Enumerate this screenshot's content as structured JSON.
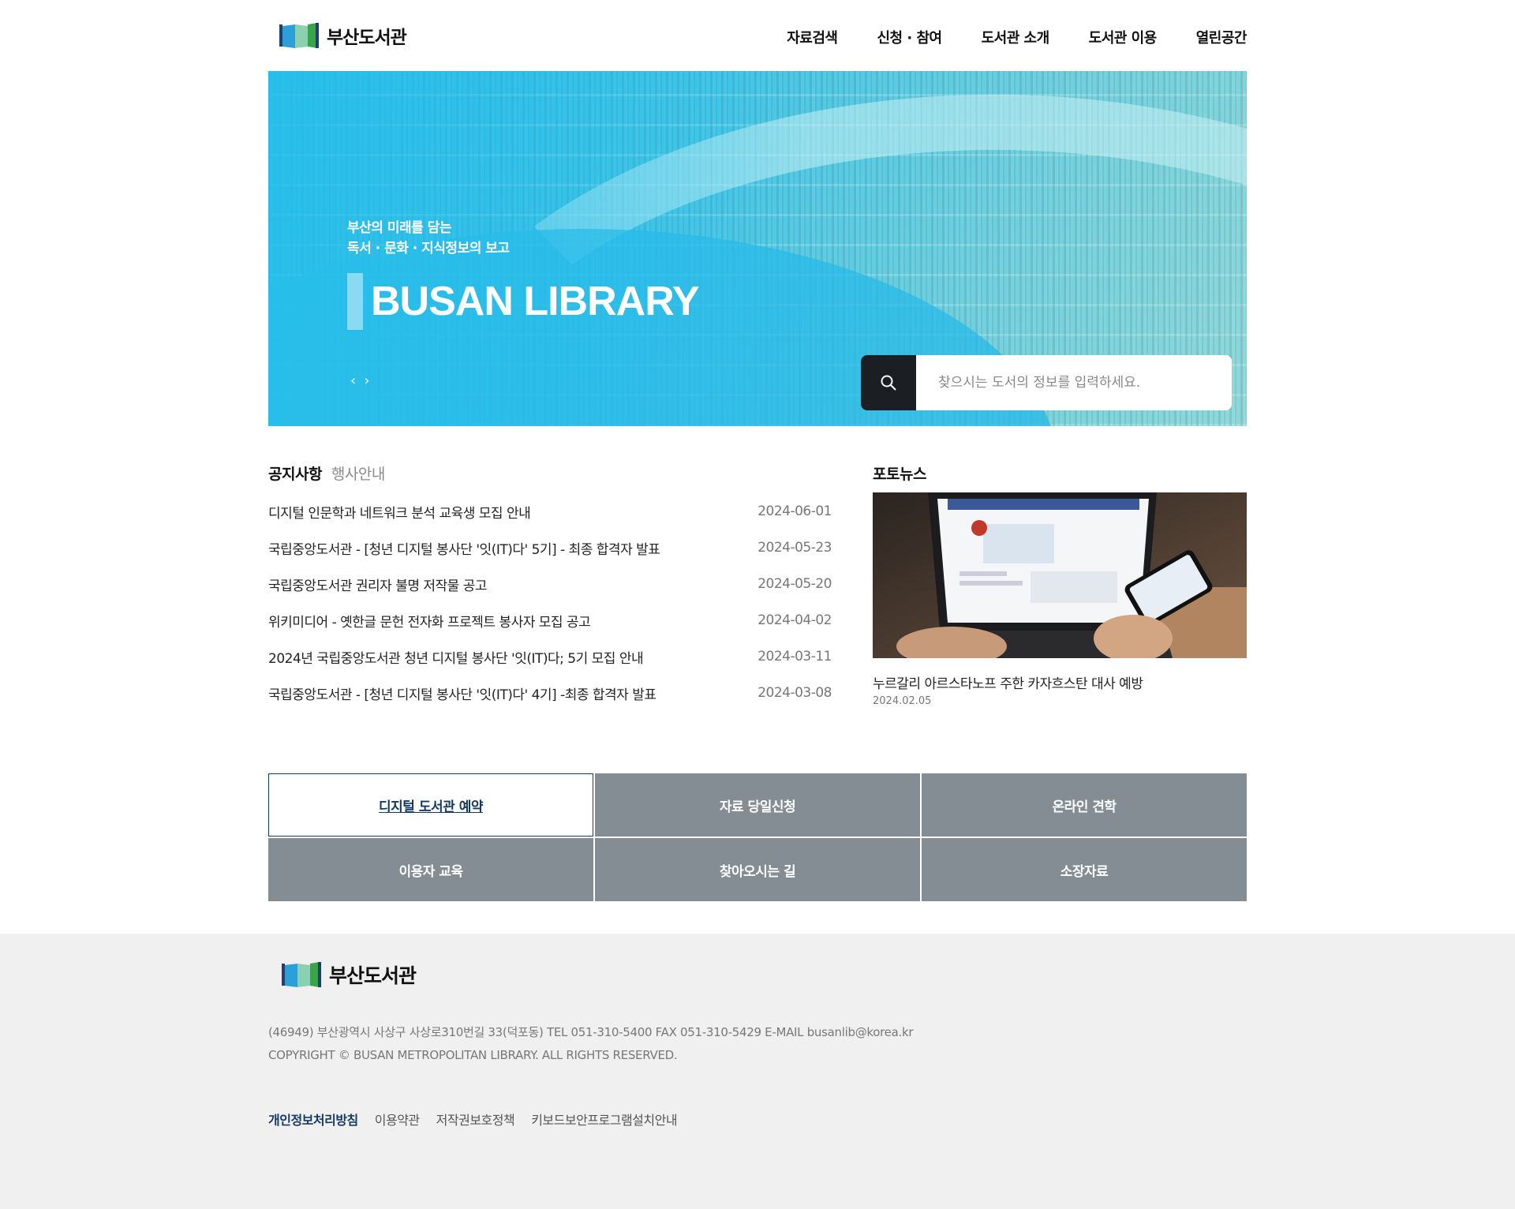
{
  "header": {
    "logo_text": "부산도서관",
    "nav": [
      "자료검색",
      "신청 · 참여",
      "도서관 소개",
      "도서관 이용",
      "열린공간"
    ]
  },
  "hero": {
    "sub_line1": "부산의 미래를 담는",
    "sub_line2": "독서 · 문화 · 지식정보의 보고",
    "title": "BUSAN LIBRARY",
    "prev": "‹",
    "next": "›",
    "search_placeholder": "찾으시는 도서의 정보를 입력하세요."
  },
  "board": {
    "tabs": [
      "공지사항",
      "행사안내"
    ],
    "notices": [
      {
        "title": "디지털 인문학과 네트워크 분석 교육생 모집 안내",
        "date": "2024-06-01"
      },
      {
        "title": "국립중앙도서관 - [청년 디지털 봉사단 '잇(IT)다' 5기] - 최종 합격자 발표",
        "date": "2024-05-23"
      },
      {
        "title": "국립중앙도서관 권리자 불명 저작물 공고",
        "date": "2024-05-20"
      },
      {
        "title": "위키미디어 - 옛한글 문헌 전자화 프로젝트 봉사자 모집 공고",
        "date": "2024-04-02"
      },
      {
        "title": "2024년 국립중앙도서관 청년 디지털 봉사단 '잇(IT)다; 5기 모집 안내",
        "date": "2024-03-11"
      },
      {
        "title": "국립중앙도서관 - [청년 디지털 봉사단 '잇(IT)다' 4기] -최종 합격자 발표",
        "date": "2024-03-08"
      }
    ]
  },
  "photo_news": {
    "title": "포토뉴스",
    "caption": "누르갈리 아르스타노프 주한 카자흐스탄 대사 예방",
    "date": "2024.02.05"
  },
  "quick_menu": [
    {
      "label": "디지털 도서관 예약",
      "active": true
    },
    {
      "label": "자료 당일신청",
      "active": false
    },
    {
      "label": "온라인 견학",
      "active": false
    },
    {
      "label": "이용자 교육",
      "active": false
    },
    {
      "label": "찾아오시는 길",
      "active": false
    },
    {
      "label": "소장자료",
      "active": false
    }
  ],
  "footer": {
    "logo_text": "부산도서관",
    "address": "(46949) 부산광역시 사상구 사상로310번길 33(덕포동) TEL 051-310-5400 FAX 051-310-5429 E-MAIL busanlib@korea.kr",
    "copyright": "COPYRIGHT © BUSAN METROPOLITAN LIBRARY. ALL RIGHTS RESERVED.",
    "links": [
      "개인정보처리방침",
      "이용약관",
      "저작권보호정책",
      "키보드보안프로그램설치안내"
    ]
  },
  "colors": {
    "brand_navy": "#153a63",
    "hero_blue": "#2bbfe8",
    "quick_gray": "#858d94",
    "footer_bg": "#f0f0f0"
  }
}
